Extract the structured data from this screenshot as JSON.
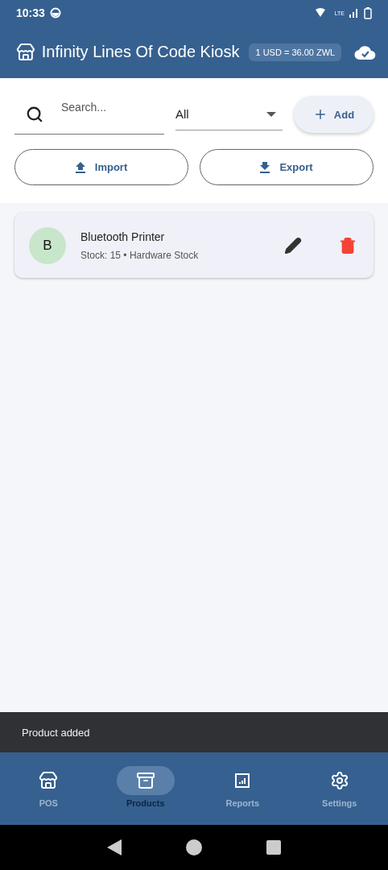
{
  "status_bar": {
    "time": "10:33",
    "network": "LTE"
  },
  "app_bar": {
    "title": "Infinity Lines Of Code Kiosk",
    "rate_badge": "1 USD = 36.00 ZWL"
  },
  "search": {
    "placeholder": "Search..."
  },
  "category_filter": {
    "value": "All"
  },
  "add_button": "Add",
  "import_button": "Import",
  "export_button": "Export",
  "products": [
    {
      "initial": "B",
      "name": "Bluetooth Printer",
      "details": "Stock: 15 • Hardware Stock"
    }
  ],
  "snackbar": {
    "message": "Product added"
  },
  "nav": [
    {
      "label": "POS",
      "selected": false
    },
    {
      "label": "Products",
      "selected": true
    },
    {
      "label": "Reports",
      "selected": false
    },
    {
      "label": "Settings",
      "selected": false
    }
  ]
}
